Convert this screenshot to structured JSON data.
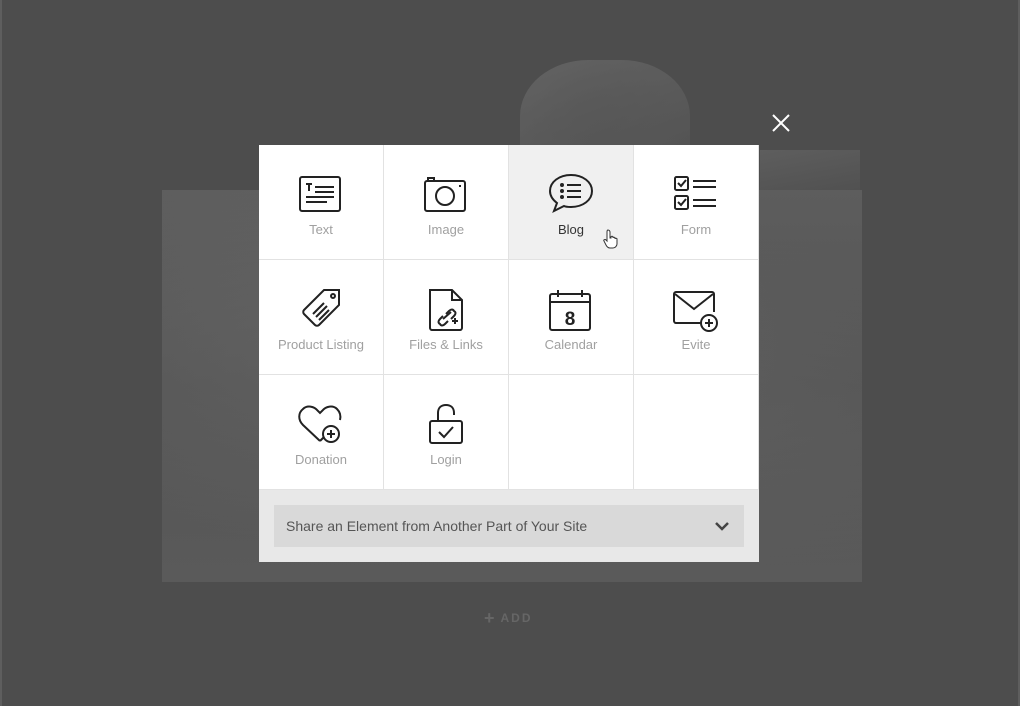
{
  "background": {
    "add_label": "ADD",
    "add_icon": "plus-icon"
  },
  "modal": {
    "close_icon": "close-icon",
    "tiles": [
      {
        "label": "Text",
        "icon": "text-block-icon",
        "state": "normal"
      },
      {
        "label": "Image",
        "icon": "camera-icon",
        "state": "normal"
      },
      {
        "label": "Blog",
        "icon": "speech-bubble-list-icon",
        "state": "hover"
      },
      {
        "label": "Form",
        "icon": "checklist-icon",
        "state": "normal"
      },
      {
        "label": "Product Listing",
        "icon": "price-tag-icon",
        "state": "normal"
      },
      {
        "label": "Files & Links",
        "icon": "file-link-icon",
        "state": "normal"
      },
      {
        "label": "Calendar",
        "icon": "calendar-icon",
        "state": "normal",
        "calendar_day": "8"
      },
      {
        "label": "Evite",
        "icon": "envelope-plus-icon",
        "state": "normal"
      },
      {
        "label": "Donation",
        "icon": "heart-plus-icon",
        "state": "normal"
      },
      {
        "label": "Login",
        "icon": "unlocked-padlock-icon",
        "state": "normal"
      }
    ],
    "share": {
      "label": "Share an Element from Another Part of Your Site",
      "icon": "chevron-down-icon"
    }
  },
  "colors": {
    "overlay": "#4d4d4d",
    "modal_footer": "#e8e8e8",
    "tile_hover": "#f0f0f0",
    "label_muted": "#a0a0a0",
    "label_active": "#333333",
    "icon_stroke": "#222222"
  }
}
